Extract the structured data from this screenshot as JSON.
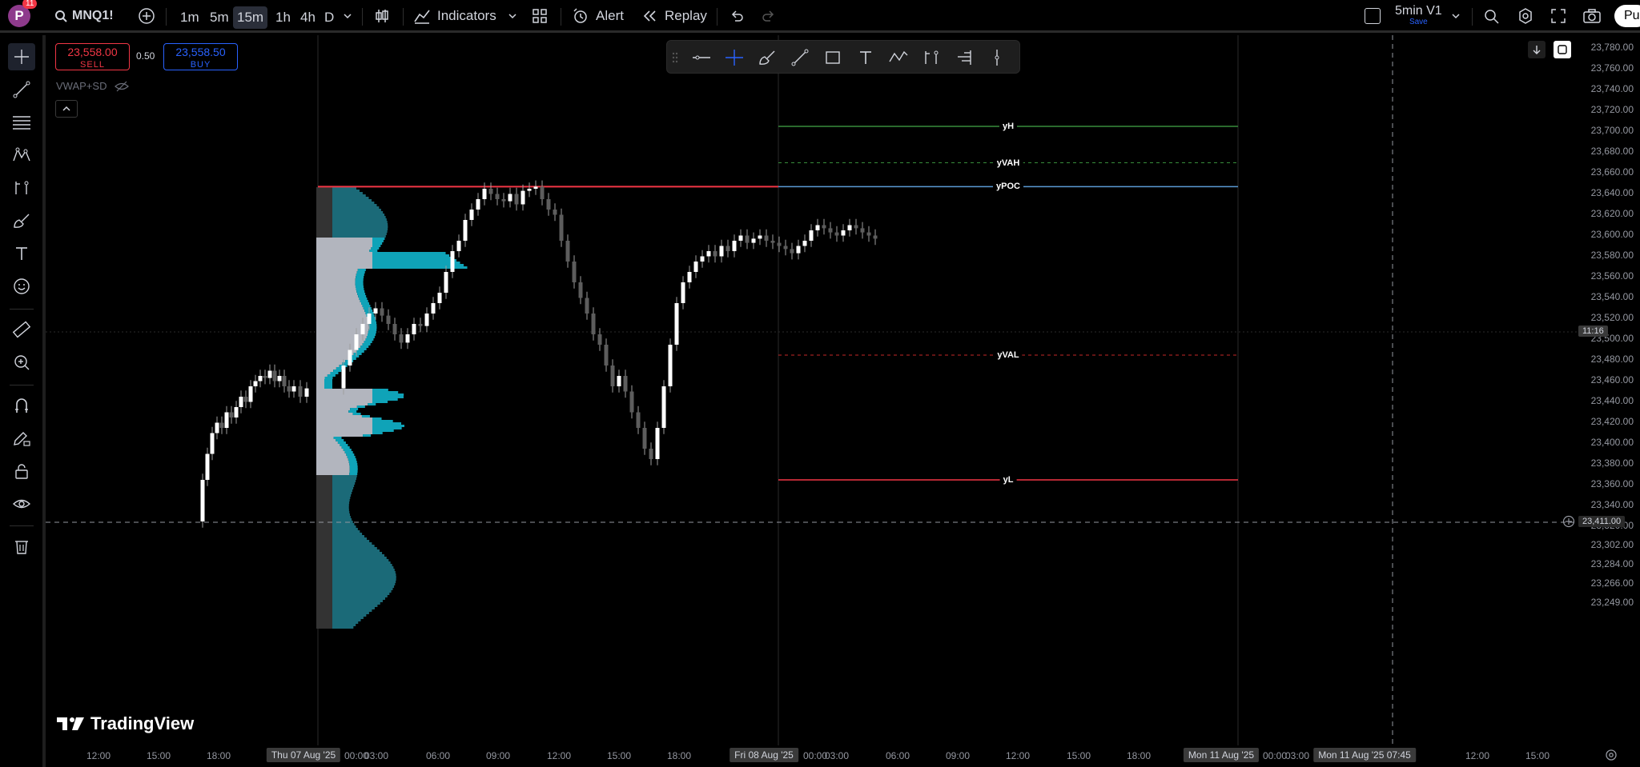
{
  "topbar": {
    "avatar_letter": "P",
    "notif_count": "11",
    "symbol": "MNQ1!",
    "timeframes": [
      "1m",
      "5m",
      "15m",
      "1h",
      "4h",
      "D"
    ],
    "active_timeframe": "15m",
    "indicators_label": "Indicators",
    "alert_label": "Alert",
    "replay_label": "Replay",
    "layout_name": "5min V1",
    "layout_save": "Save",
    "publish_label": "Pu"
  },
  "order": {
    "sell_price": "23,558.00",
    "sell_label": "SELL",
    "spread": "0.50",
    "buy_price": "23,558.50",
    "buy_label": "BUY"
  },
  "indicator_legend": {
    "name": "VWAP+SD"
  },
  "levels": [
    {
      "label": "yH",
      "price": 23670,
      "color": "#388e3c",
      "style": "solid"
    },
    {
      "label": "yVAH",
      "price": 23635,
      "color": "#388e3c",
      "style": "dashed"
    },
    {
      "label": "yPOC",
      "price": 23612,
      "color": "#5b9bd5",
      "style": "solid"
    },
    {
      "label": "yVAL",
      "price": 23450,
      "color": "#c62828",
      "style": "dashed"
    },
    {
      "label": "yL",
      "price": 23330,
      "color": "#f23645",
      "style": "solid"
    }
  ],
  "price_axis": {
    "labels": [
      "23,780.00",
      "23,760.00",
      "23,740.00",
      "23,720.00",
      "23,700.00",
      "23,680.00",
      "23,660.00",
      "23,640.00",
      "23,620.00",
      "23,600.00",
      "23,580.00",
      "23,560.00",
      "23,540.00",
      "23,520.00",
      "23,500.00",
      "23,480.00",
      "23,460.00",
      "23,440.00",
      "23,420.00",
      "23,400.00",
      "23,380.00",
      "23,360.00",
      "23,340.00",
      "23,320.00",
      "23,302.00",
      "23,284.00",
      "23,266.00",
      "23,249.00"
    ],
    "current_time_tag": "11:16",
    "crosshair_price": "23,411.00"
  },
  "time_axis": {
    "labels": [
      "12:00",
      "15:00",
      "18:00",
      "Thu 07 Aug '25",
      "00:00",
      "03:00",
      "06:00",
      "09:00",
      "12:00",
      "15:00",
      "18:00",
      "Fri 08 Aug '25",
      "00:00",
      "03:00",
      "06:00",
      "09:00",
      "12:00",
      "15:00",
      "18:00",
      "Mon 11 Aug '25",
      "00:00",
      "03:00",
      "Mon 11 Aug '25   07:45",
      "12:00",
      "15:00"
    ]
  },
  "watermark": "TradingView",
  "colors": {
    "background": "#000000",
    "profile_cyan": "#0fa3b8",
    "profile_grey": "#b2b5be",
    "poc_red": "#f23645",
    "buy_blue": "#2962ff",
    "sell_red": "#f23645"
  }
}
